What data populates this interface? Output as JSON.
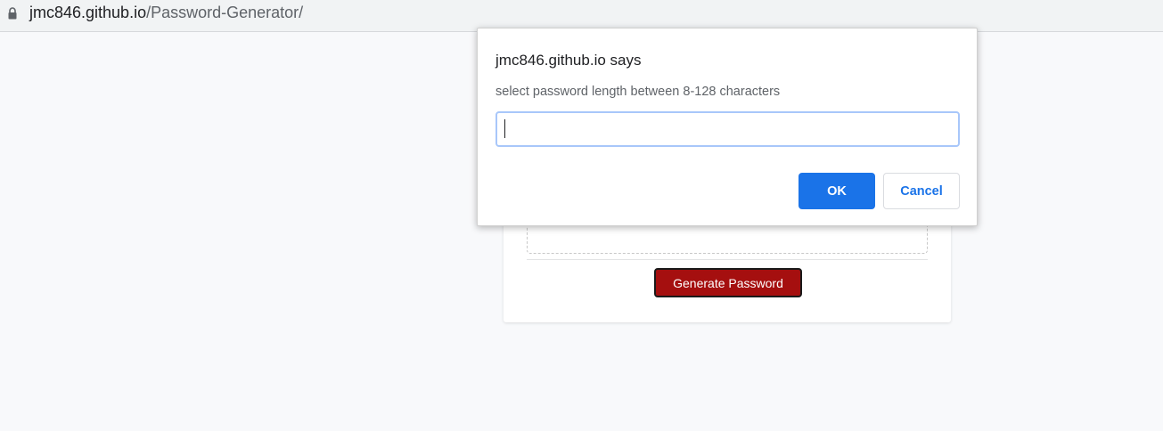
{
  "browser": {
    "url_host": "jmc846.github.io",
    "url_path": "/Password-Generator/",
    "lock_icon": "lock-icon"
  },
  "page": {
    "generate_button_label": "Generate Password"
  },
  "dialog": {
    "title": "jmc846.github.io says",
    "message": "select password length between 8-128 characters",
    "input_value": "",
    "ok_label": "OK",
    "cancel_label": "Cancel"
  },
  "colors": {
    "accent": "#1a73e8",
    "generate_button": "#a50f0f",
    "page_background": "#f8f9fb"
  }
}
